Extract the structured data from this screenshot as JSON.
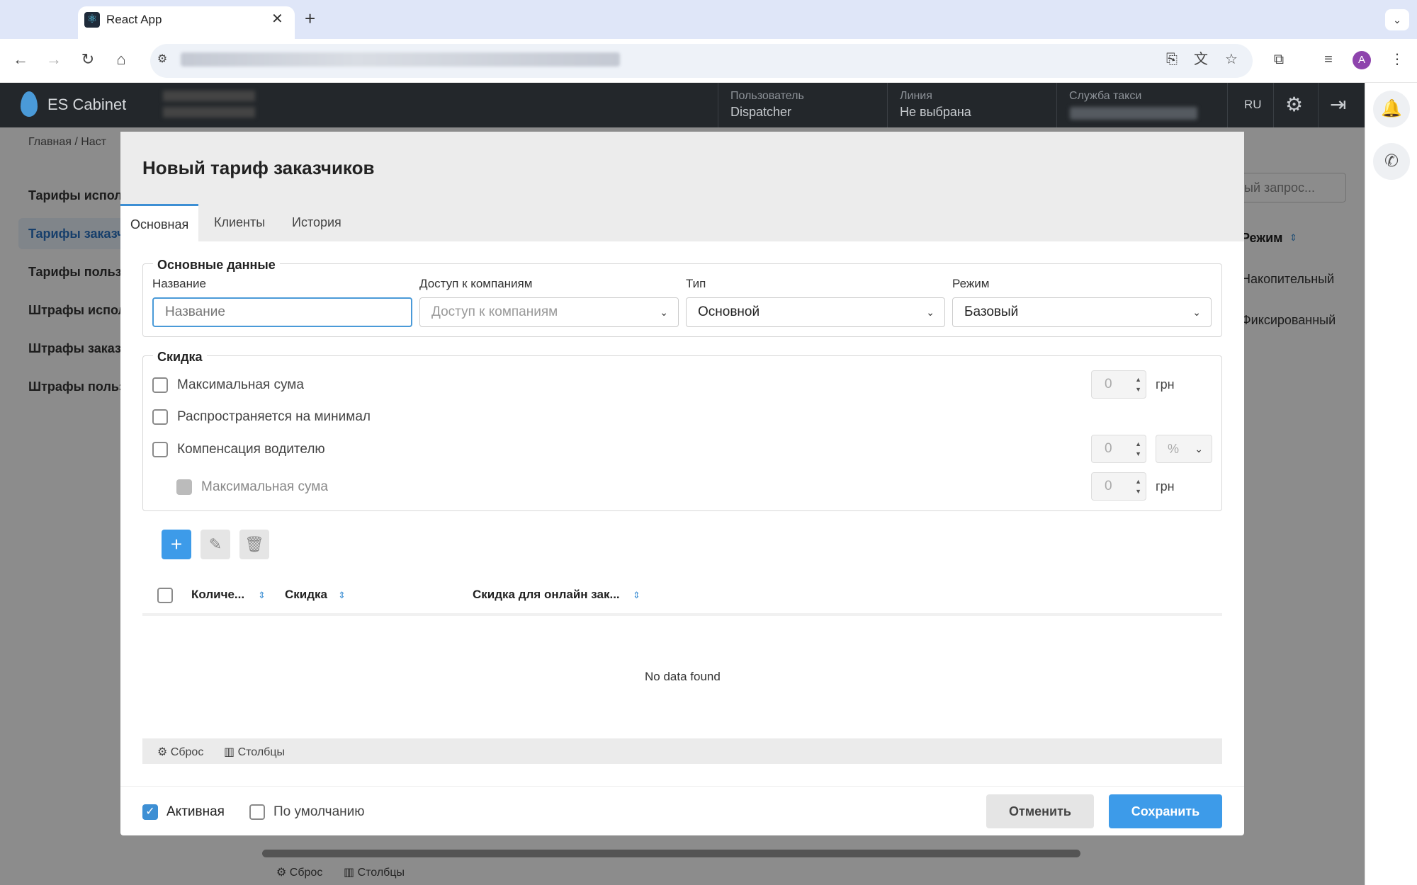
{
  "browser": {
    "tab_title": "React App",
    "tab_close": "✕",
    "new_tab": "+",
    "icons": [
      "react-icon",
      "back-icon",
      "forward-icon",
      "reload-icon",
      "home-icon",
      "site-info-icon",
      "install-icon",
      "translate-icon",
      "star-icon",
      "extensions-icon",
      "media-icon",
      "menu-icon"
    ],
    "avatar_letter": "A"
  },
  "header": {
    "app_name": "ES Cabinet",
    "user_label": "Пользователь",
    "user_value": "Dispatcher",
    "line_label": "Линия",
    "line_value": "Не выбрана",
    "taxi_label": "Служба такси",
    "lang": "RU"
  },
  "background": {
    "breadcrumb": "Главная  /  Наст",
    "sidebar": [
      "Тарифы испол",
      "Тарифы заказч",
      "Тарифы польз",
      "Штрафы испол",
      "Штрафы заказ",
      "Штрафы польз"
    ],
    "search_placeholder": "ый запрос...",
    "column": "Режим",
    "rows": [
      "Накопительный",
      "Фиксированный"
    ],
    "footer": {
      "reset": "Сброс",
      "columns": "Столбцы"
    }
  },
  "modal": {
    "title": "Новый тариф заказчиков",
    "tabs": [
      "Основная",
      "Клиенты",
      "История"
    ],
    "basic": {
      "legend": "Основные данные",
      "name_label": "Название",
      "name_placeholder": "Название",
      "access_label": "Доступ к компаниям",
      "access_placeholder": "Доступ к компаниям",
      "type_label": "Тип",
      "type_value": "Основной",
      "mode_label": "Режим",
      "mode_value": "Базовый"
    },
    "discount": {
      "legend": "Скидка",
      "max_sum": "Максимальная сума",
      "min_spread": "Распространяется на минимал",
      "driver_comp": "Компенсация водителю",
      "max_sum_sub": "Максимальная сума",
      "value1": "0",
      "value2": "0",
      "value3": "0",
      "unit_grn": "грн",
      "unit_pct": "%"
    },
    "table": {
      "columns": [
        "Количе...",
        "Скидка",
        "Скидка для онлайн зак..."
      ],
      "empty": "No data found",
      "footer": {
        "reset": "Сброс",
        "columns": "Столбцы"
      }
    },
    "footer": {
      "active_label": "Активная",
      "active_checked": true,
      "default_label": "По умолчанию",
      "default_checked": false,
      "cancel": "Отменить",
      "save": "Сохранить"
    }
  },
  "colors": {
    "accent": "#3d9be9",
    "header_bg": "#23272b",
    "overlay": "rgba(0,0,0,0.45)"
  }
}
